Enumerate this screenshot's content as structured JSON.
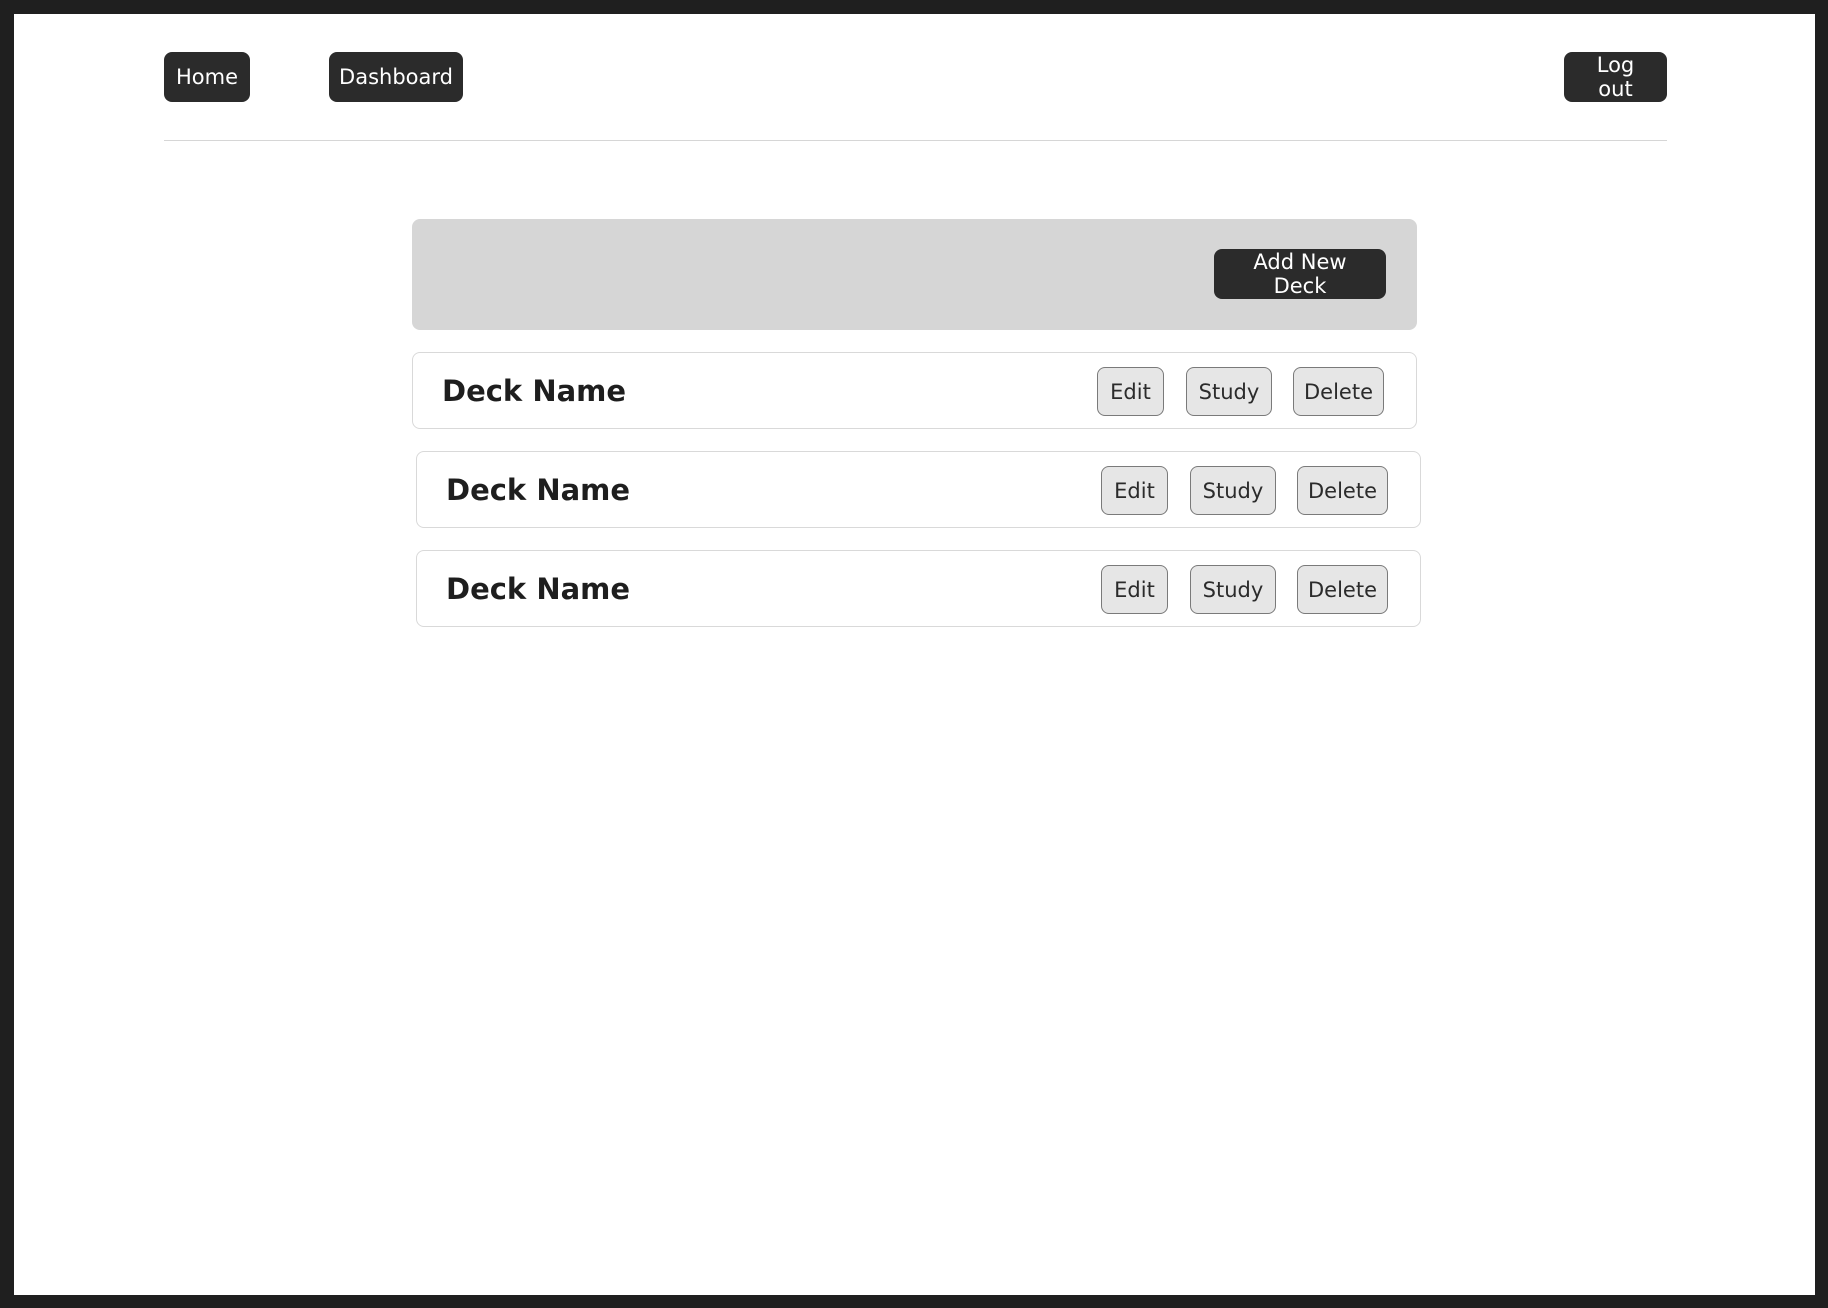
{
  "nav": {
    "home_label": "Home",
    "dashboard_label": "Dashboard",
    "logout_label": "Log out"
  },
  "toolbar": {
    "add_deck_label": "Add New Deck"
  },
  "decks": [
    {
      "name": "Deck Name",
      "edit_label": "Edit",
      "study_label": "Study",
      "delete_label": "Delete"
    },
    {
      "name": "Deck Name",
      "edit_label": "Edit",
      "study_label": "Study",
      "delete_label": "Delete"
    },
    {
      "name": "Deck Name",
      "edit_label": "Edit",
      "study_label": "Study",
      "delete_label": "Delete"
    }
  ],
  "colors": {
    "dark_button": "#2b2b2b",
    "panel_gray": "#d6d6d6",
    "light_button": "#e6e6e6"
  }
}
